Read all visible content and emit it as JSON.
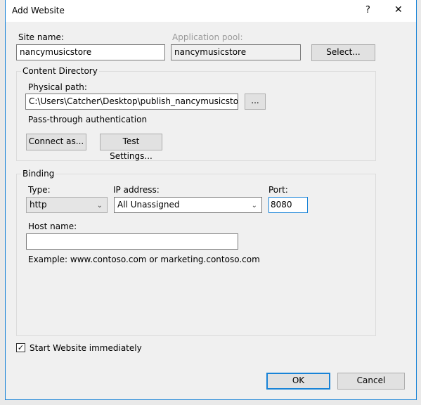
{
  "window": {
    "title": "Add Website",
    "help": "?",
    "close": "✕"
  },
  "site_name": {
    "label": "Site name:",
    "value": "nancymusicstore"
  },
  "app_pool": {
    "label": "Application pool:",
    "value": "nancymusicstore",
    "select_button": "Select..."
  },
  "content_directory": {
    "legend": "Content Directory",
    "physical_path_label": "Physical path:",
    "physical_path_value": "C:\\Users\\Catcher\\Desktop\\publish_nancymusicstore",
    "browse_button": "...",
    "auth_text": "Pass-through authentication",
    "connect_as_button": "Connect as...",
    "test_settings_button": "Test Settings..."
  },
  "binding": {
    "legend": "Binding",
    "type_label": "Type:",
    "type_value": "http",
    "ip_label": "IP address:",
    "ip_value": "All Unassigned",
    "port_label": "Port:",
    "port_value": "8080",
    "host_label": "Host name:",
    "host_value": "",
    "example": "Example: www.contoso.com or marketing.contoso.com"
  },
  "start_immediately": {
    "label": "Start Website immediately",
    "checked": true
  },
  "footer": {
    "ok": "OK",
    "cancel": "Cancel"
  },
  "colors": {
    "accent": "#1883d7",
    "dialog_bg": "#f0f0f0"
  }
}
